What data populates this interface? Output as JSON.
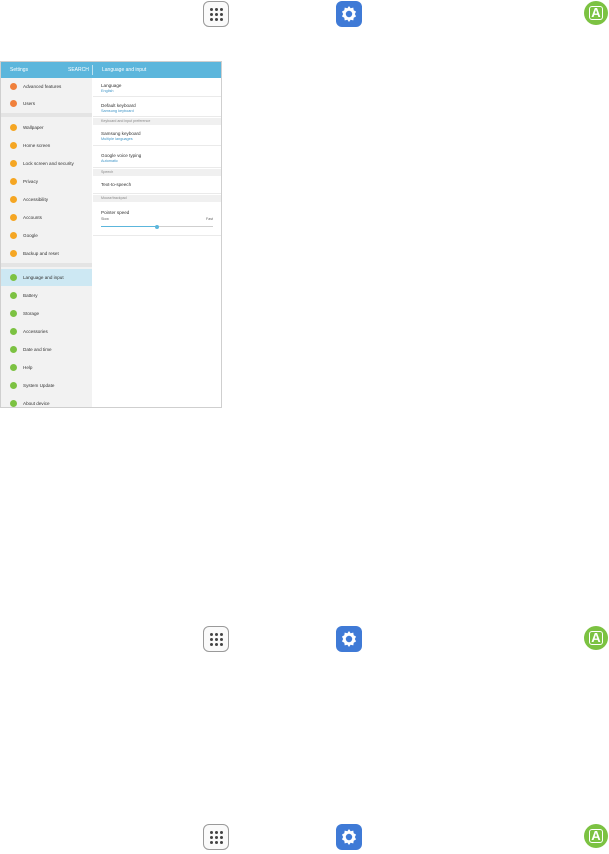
{
  "icon_rows": [
    {
      "apps_icon": "apps-grid-icon",
      "settings_icon": "gear-icon",
      "language_icon": "language-a-icon",
      "language_glyph": "A"
    },
    {
      "apps_icon": "apps-grid-icon",
      "settings_icon": "gear-icon",
      "language_icon": "language-a-icon",
      "language_glyph": "A"
    },
    {
      "apps_icon": "apps-grid-icon",
      "settings_icon": "gear-icon",
      "language_icon": "language-a-icon",
      "language_glyph": "A"
    }
  ],
  "screen": {
    "topbar": {
      "title": "Settings",
      "search": "SEARCH",
      "detail_title": "Language and input"
    },
    "sidebar": {
      "items": [
        {
          "label": "Advanced features",
          "color": "#f0803c"
        },
        {
          "label": "Users",
          "color": "#f0803c"
        },
        {
          "label": "Wallpaper",
          "color": "#f5a623"
        },
        {
          "label": "Home screen",
          "color": "#f5a623"
        },
        {
          "label": "Lock screen and security",
          "color": "#f5a623"
        },
        {
          "label": "Privacy",
          "color": "#f5a623"
        },
        {
          "label": "Accessibility",
          "color": "#f5a623"
        },
        {
          "label": "Accounts",
          "color": "#f5a623"
        },
        {
          "label": "Google",
          "color": "#f5a623"
        },
        {
          "label": "Backup and reset",
          "color": "#f5a623"
        },
        {
          "label": "Language and input",
          "color": "#7cc242"
        },
        {
          "label": "Battery",
          "color": "#7cc242"
        },
        {
          "label": "Storage",
          "color": "#7cc242"
        },
        {
          "label": "Accessories",
          "color": "#7cc242"
        },
        {
          "label": "Date and time",
          "color": "#7cc242"
        },
        {
          "label": "Help",
          "color": "#7cc242"
        },
        {
          "label": "System Update",
          "color": "#7cc242"
        },
        {
          "label": "About device",
          "color": "#7cc242"
        }
      ],
      "active": "Language and input"
    },
    "detail": {
      "language": {
        "title": "Language",
        "value": "English"
      },
      "default_keyboard": {
        "title": "Default keyboard",
        "value": "Samsung keyboard"
      },
      "section_keyboard": "Keyboard and input preference",
      "samsung_keyboard": {
        "title": "Samsung keyboard",
        "value": "Multiple languages"
      },
      "google_voice": {
        "title": "Google voice typing",
        "value": "Automatic"
      },
      "section_speech": "Speech",
      "tts": {
        "title": "Text-to-speech"
      },
      "section_mouse": "Mouse/trackpad",
      "pointer": {
        "title": "Pointer speed",
        "min_label": "Slow",
        "max_label": "Fast",
        "level": 0.5
      }
    }
  }
}
